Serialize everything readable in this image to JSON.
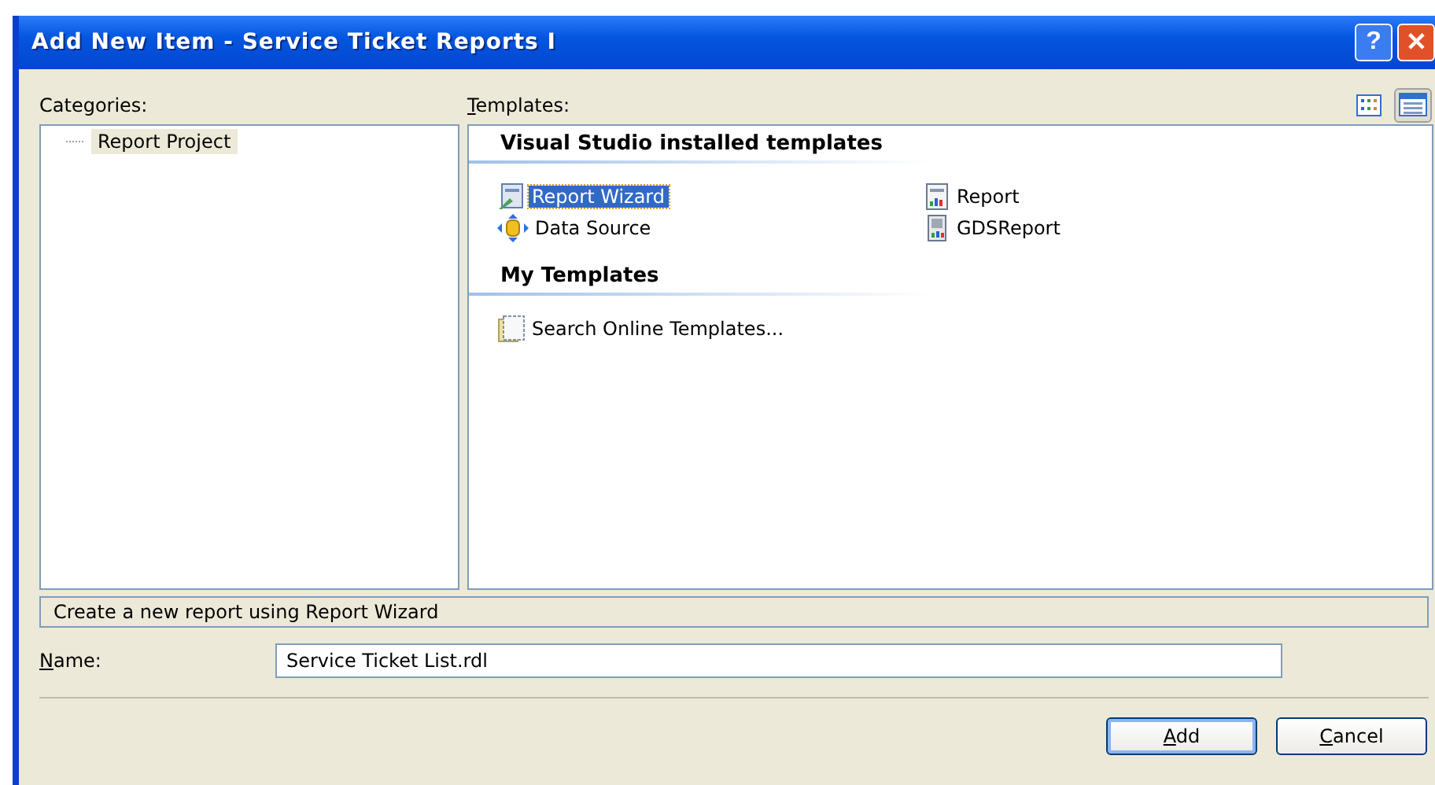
{
  "window": {
    "title": "Add New Item - Service Ticket Reports I",
    "buttons": [
      {
        "kind": "help",
        "label": "?"
      },
      {
        "kind": "close",
        "label": "✕"
      }
    ]
  },
  "categories": {
    "label": "Categories:",
    "items": [
      {
        "label": "Report Project",
        "selected": true
      }
    ]
  },
  "templates": {
    "label": "Templates:",
    "view_buttons": [
      {
        "kind": "large-icons",
        "selected": false
      },
      {
        "kind": "small-icons",
        "selected": true
      }
    ],
    "groups": [
      {
        "title": "Visual Studio installed templates",
        "items": [
          {
            "label": "Report Wizard",
            "kind": "wizard",
            "selected": true
          },
          {
            "label": "Report",
            "kind": "report",
            "selected": false
          },
          {
            "label": "Data Source",
            "kind": "datasource",
            "selected": false
          },
          {
            "label": "GDSReport",
            "kind": "gdsreport",
            "selected": false
          }
        ]
      },
      {
        "title": "My Templates",
        "items": [
          {
            "label": "Search Online Templates...",
            "kind": "search",
            "selected": false
          }
        ]
      }
    ]
  },
  "description": "Create a new report using Report Wizard",
  "name_field": {
    "label": "Name:",
    "value": "Service Ticket List.rdl"
  },
  "buttons": [
    {
      "label": "Add",
      "default": true
    },
    {
      "label": "Cancel",
      "default": false
    }
  ]
}
